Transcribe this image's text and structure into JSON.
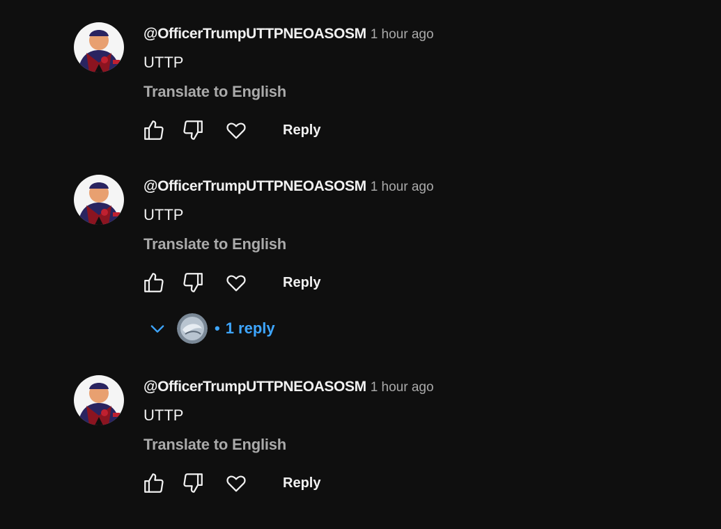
{
  "comments": [
    {
      "author": "@OfficerTrumpUTTPNEOASOSM",
      "timestamp": "1 hour ago",
      "text": "UTTP",
      "translate_label": "Translate to English",
      "reply_label": "Reply"
    },
    {
      "author": "@OfficerTrumpUTTPNEOASOSM",
      "timestamp": "1 hour ago",
      "text": "UTTP",
      "translate_label": "Translate to English",
      "reply_label": "Reply",
      "replies_label": "1 reply"
    },
    {
      "author": "@OfficerTrumpUTTPNEOASOSM",
      "timestamp": "1 hour ago",
      "text": "UTTP",
      "translate_label": "Translate to English",
      "reply_label": "Reply"
    }
  ],
  "colors": {
    "background": "#0f0f0f",
    "primary_text": "#f1f1f1",
    "secondary_text": "#aaaaaa",
    "link_blue": "#3ea6ff"
  },
  "icons": {
    "like": "thumbs-up-icon",
    "dislike": "thumbs-down-icon",
    "heart": "heart-icon",
    "expand": "chevron-down-icon"
  }
}
